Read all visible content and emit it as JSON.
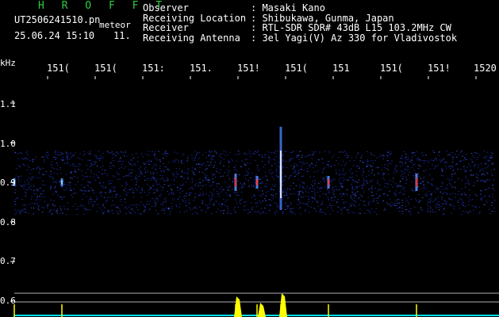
{
  "header": {
    "brand": "H R O F F T",
    "filename": "UT2506241510.pn",
    "mode": "meteor",
    "datetime": "25.06.24 15:10",
    "count": "11.",
    "info_labels": [
      "Observer",
      "Receiving Location",
      "Receiver",
      "Receiving Antenna"
    ],
    "info_values": [
      ": Masaki Kano",
      ": Shibukawa, Gunma, Japan",
      ": RTL-SDR SDR# 43dB L15 103.2MHz CW",
      ": 3el Yagi(V) Az 330 for Vladivostok"
    ]
  },
  "axis": {
    "unit": "kHz",
    "freq_labels": [
      "151(",
      "151(",
      "151:",
      "151.",
      "151!",
      "151(",
      "151",
      "151(",
      "151!",
      "1520"
    ],
    "y_labels": [
      "1.1",
      "1.0",
      "0.9",
      "0.8",
      "0.7",
      "0.6"
    ]
  },
  "colors": {
    "background": "#000000",
    "text": "#ffffff",
    "brand": "#2ecc40",
    "noise": "#1a2a9a",
    "trace": "#ffff00",
    "baseline": "#00e0ff"
  },
  "chart_data": {
    "type": "heatmap",
    "xlabel": "",
    "ylabel": "kHz",
    "yticks": [
      1.1,
      1.0,
      0.9,
      0.8,
      0.7,
      0.6
    ],
    "minute_ticks": [
      1511,
      1512,
      1513,
      1514,
      1515,
      1516,
      1517,
      1518,
      1519,
      1520
    ],
    "echoes": [
      {
        "minute": 1510.3,
        "freq": 0.9,
        "strength": "weak"
      },
      {
        "minute": 1511.3,
        "freq": 0.9,
        "strength": "weak"
      },
      {
        "minute": 1514.95,
        "freq": 0.9,
        "strength": "strong"
      },
      {
        "minute": 1515.4,
        "freq": 0.9,
        "strength": "medium"
      },
      {
        "minute": 1515.9,
        "freq": 0.92,
        "strength": "strong"
      },
      {
        "minute": 1516.9,
        "freq": 0.9,
        "strength": "medium"
      },
      {
        "minute": 1518.75,
        "freq": 0.9,
        "strength": "strong"
      }
    ]
  }
}
